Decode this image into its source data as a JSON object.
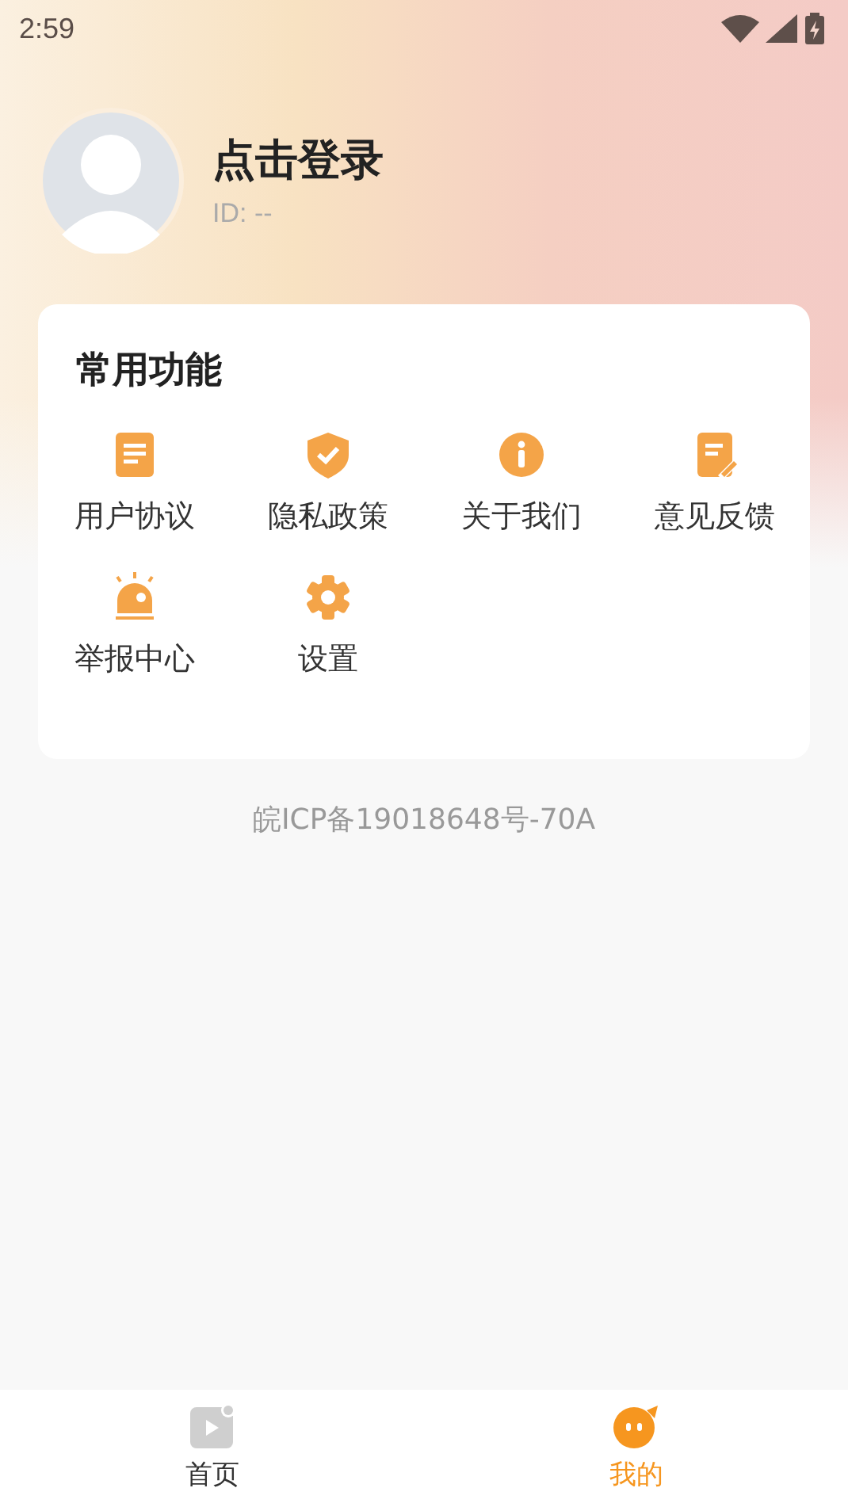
{
  "status_bar": {
    "time": "2:59"
  },
  "profile": {
    "name": "点击登录",
    "id": "ID: --"
  },
  "functions": {
    "title": "常用功能",
    "items": [
      {
        "label": "用户协议",
        "kind": "document"
      },
      {
        "label": "隐私政策",
        "kind": "shield"
      },
      {
        "label": "关于我们",
        "kind": "info"
      },
      {
        "label": "意见反馈",
        "kind": "feedback"
      },
      {
        "label": "举报中心",
        "kind": "alarm"
      },
      {
        "label": "设置",
        "kind": "gear"
      }
    ]
  },
  "footer": "皖ICP备19018648号-70A",
  "nav": [
    {
      "label": "首页",
      "kind": "video",
      "selected": false
    },
    {
      "label": "我的",
      "kind": "face",
      "selected": true
    }
  ]
}
